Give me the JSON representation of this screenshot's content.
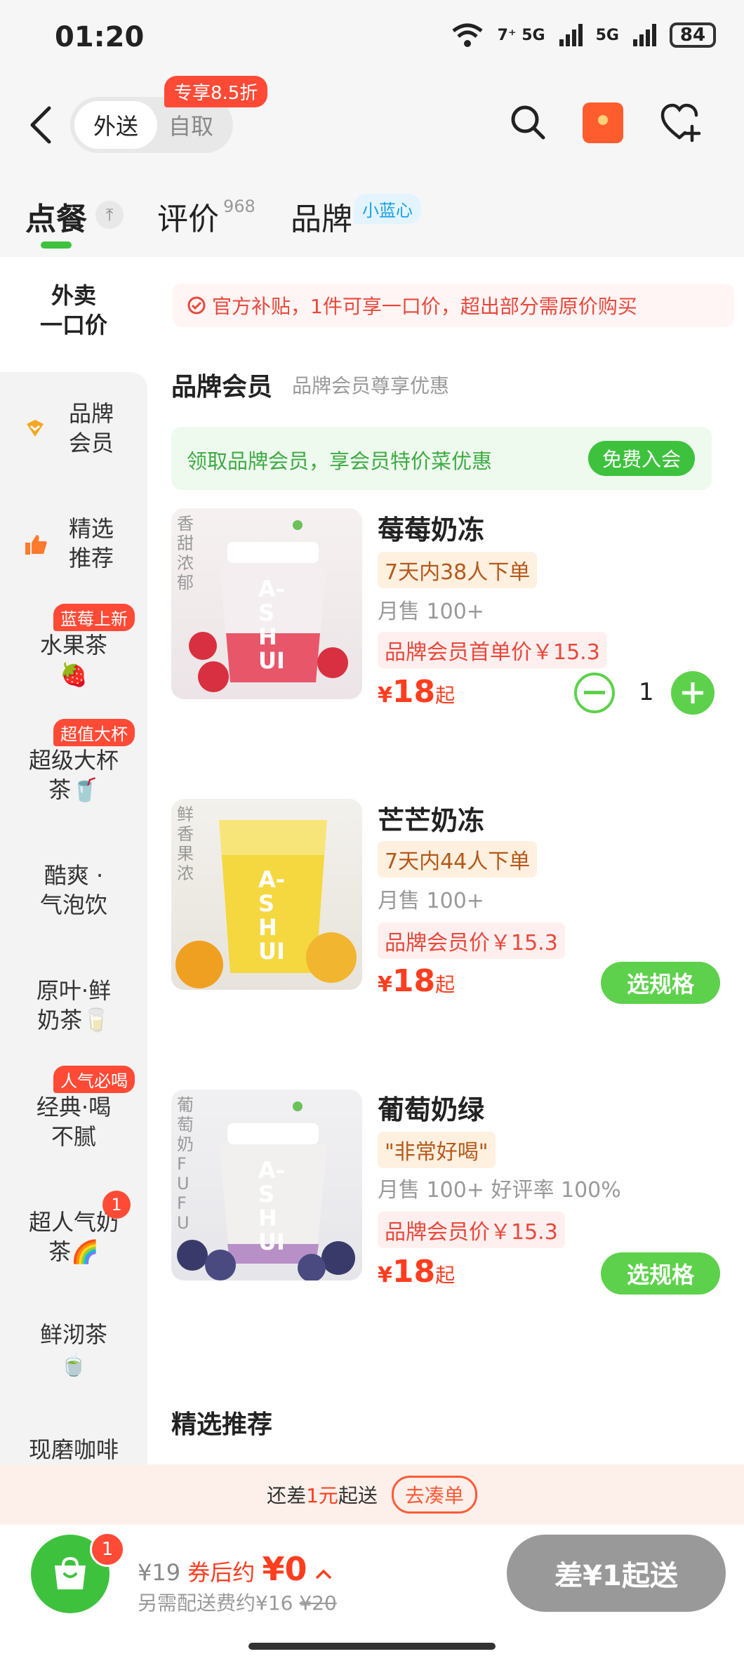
{
  "status_bar": {
    "time": "01:20",
    "network1": "7⁺ 5G",
    "network2": "5G",
    "battery": "84"
  },
  "header": {
    "mode_active": "外送",
    "mode_other": "自取",
    "promo_badge": "专享8.5折"
  },
  "tabs": [
    {
      "label": "点餐"
    },
    {
      "label": "评价",
      "count": "968"
    },
    {
      "label": "品牌",
      "tag": "小蓝心"
    }
  ],
  "sidebar": {
    "top": "外卖\n一口价",
    "items": [
      {
        "label": "品牌\n会员"
      },
      {
        "label": "精选\n推荐"
      },
      {
        "label": "水果茶\n🍓",
        "badge": "蓝莓上新"
      },
      {
        "label": "超级大杯\n茶🥤",
        "badge": "超值大杯"
      },
      {
        "label": "酷爽 ·\n气泡饮"
      },
      {
        "label": "原叶·鲜\n奶茶🥛"
      },
      {
        "label": "经典·喝\n不腻",
        "badge": "人气必喝"
      },
      {
        "label": "超人气奶\n茶🌈",
        "count": "1"
      },
      {
        "label": "鲜沏茶\n🍵"
      },
      {
        "label": "现磨咖啡"
      }
    ]
  },
  "subsidy_notice": "官方补贴，1件可享一口价，超出部分需原价购买",
  "section_member": {
    "title": "品牌会员",
    "subtitle": "品牌会员尊享优惠"
  },
  "member_bar": {
    "text": "领取品牌会员，享会员特价菜优惠",
    "button": "免费入会"
  },
  "products": [
    {
      "name": "莓莓奶冻",
      "tag": "7天内38人下单",
      "sold": "月售 100+",
      "member_price": "品牌会员首单价￥15.3",
      "currency": "¥",
      "price": "18",
      "suffix": "起",
      "quantity": "1",
      "img_text": "香甜浓郁",
      "cup_text": "A-SHUI"
    },
    {
      "name": "芒芒奶冻",
      "tag": "7天内44人下单",
      "sold": "月售 100+",
      "member_price": "品牌会员价￥15.3",
      "currency": "¥",
      "price": "18",
      "suffix": "起",
      "button": "选规格",
      "img_text": "鲜香果浓",
      "cup_text": "A-SHUI"
    },
    {
      "name": "葡萄奶绿",
      "tag": "\"非常好喝\"",
      "sold": "月售 100+ 好评率 100%",
      "member_price": "品牌会员价￥15.3",
      "currency": "¥",
      "price": "18",
      "suffix": "起",
      "button": "选规格",
      "img_text": "葡萄奶FUFU",
      "cup_text": "A-SHUI"
    }
  ],
  "section_recommend": {
    "title": "精选推荐"
  },
  "gap_bar": {
    "prefix": "还差",
    "amount": "1元",
    "suffix": "起送",
    "button": "去凑单"
  },
  "cart": {
    "badge": "1",
    "total": "¥19",
    "after_label": "券后约",
    "after_value": "¥0",
    "fee_label": "另需配送费约¥16",
    "fee_original": "¥20",
    "checkout": "差¥1起送"
  },
  "colors": {
    "accent_green": "#3ec23e",
    "price_red": "#ff3d1f",
    "badge_red": "#ff4a36"
  }
}
